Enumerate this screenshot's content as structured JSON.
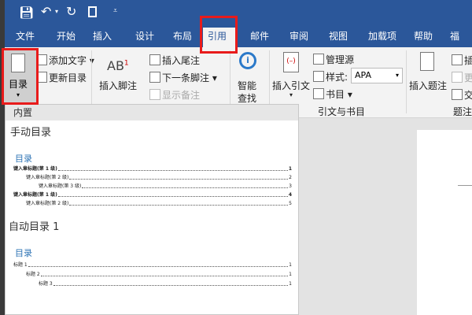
{
  "quick_access": {
    "save_icon": "save-icon",
    "undo_icon": "undo-icon",
    "redo_icon": "redo-icon",
    "new_icon": "new-doc-icon",
    "customize_icon": "customize-icon"
  },
  "tabs": [
    "文件",
    "开始",
    "插入",
    "设计",
    "布局",
    "引用",
    "邮件",
    "审阅",
    "视图",
    "加载项",
    "帮助",
    "福昕阅"
  ],
  "active_tab": "引用",
  "ribbon": {
    "toc": "目录",
    "add_text": "添加文字",
    "update_toc": "更新目录",
    "insert_footnote": "插入脚注",
    "footnote_icon_text": "AB",
    "footnote_sup": "1",
    "insert_endnote": "插入尾注",
    "next_footnote": "下一条脚注",
    "show_notes": "显示备注",
    "smart_lookup_1": "智能",
    "smart_lookup_2": "查找",
    "insert_citation": "插入引文",
    "manage_sources": "管理源",
    "style_label": "样式:",
    "style_value": "APA",
    "bibliography": "书目",
    "group_citations": "引文与书目",
    "insert_caption": "插入题注",
    "insert_table_figures": "插",
    "update_table": "更",
    "cross_ref": "交",
    "group_captions": "题注"
  },
  "panel": {
    "header": "内置",
    "manual_title": "手动目录",
    "manual_toc_heading": "目录",
    "manual_entries": [
      {
        "text": "键入章标题(第 1 级)",
        "page": "1"
      },
      {
        "text": "键入章标题(第 2 级)",
        "page": "2"
      },
      {
        "text": "键入章标题(第 3 级)",
        "page": "3"
      },
      {
        "text": "键入章标题(第 1 级)",
        "page": "4"
      },
      {
        "text": "键入章标题(第 2 级)",
        "page": "5"
      }
    ],
    "auto_title": "自动目录 1",
    "auto_toc_heading": "目录",
    "auto_entries": [
      {
        "text": "标题 1",
        "page": "1"
      },
      {
        "text": "标题 2",
        "page": "1"
      },
      {
        "text": "标题 3",
        "page": "1"
      }
    ]
  },
  "colors": {
    "brand": "#2b579a",
    "highlight": "#e81b1b",
    "toc_heading": "#2e74b5"
  }
}
